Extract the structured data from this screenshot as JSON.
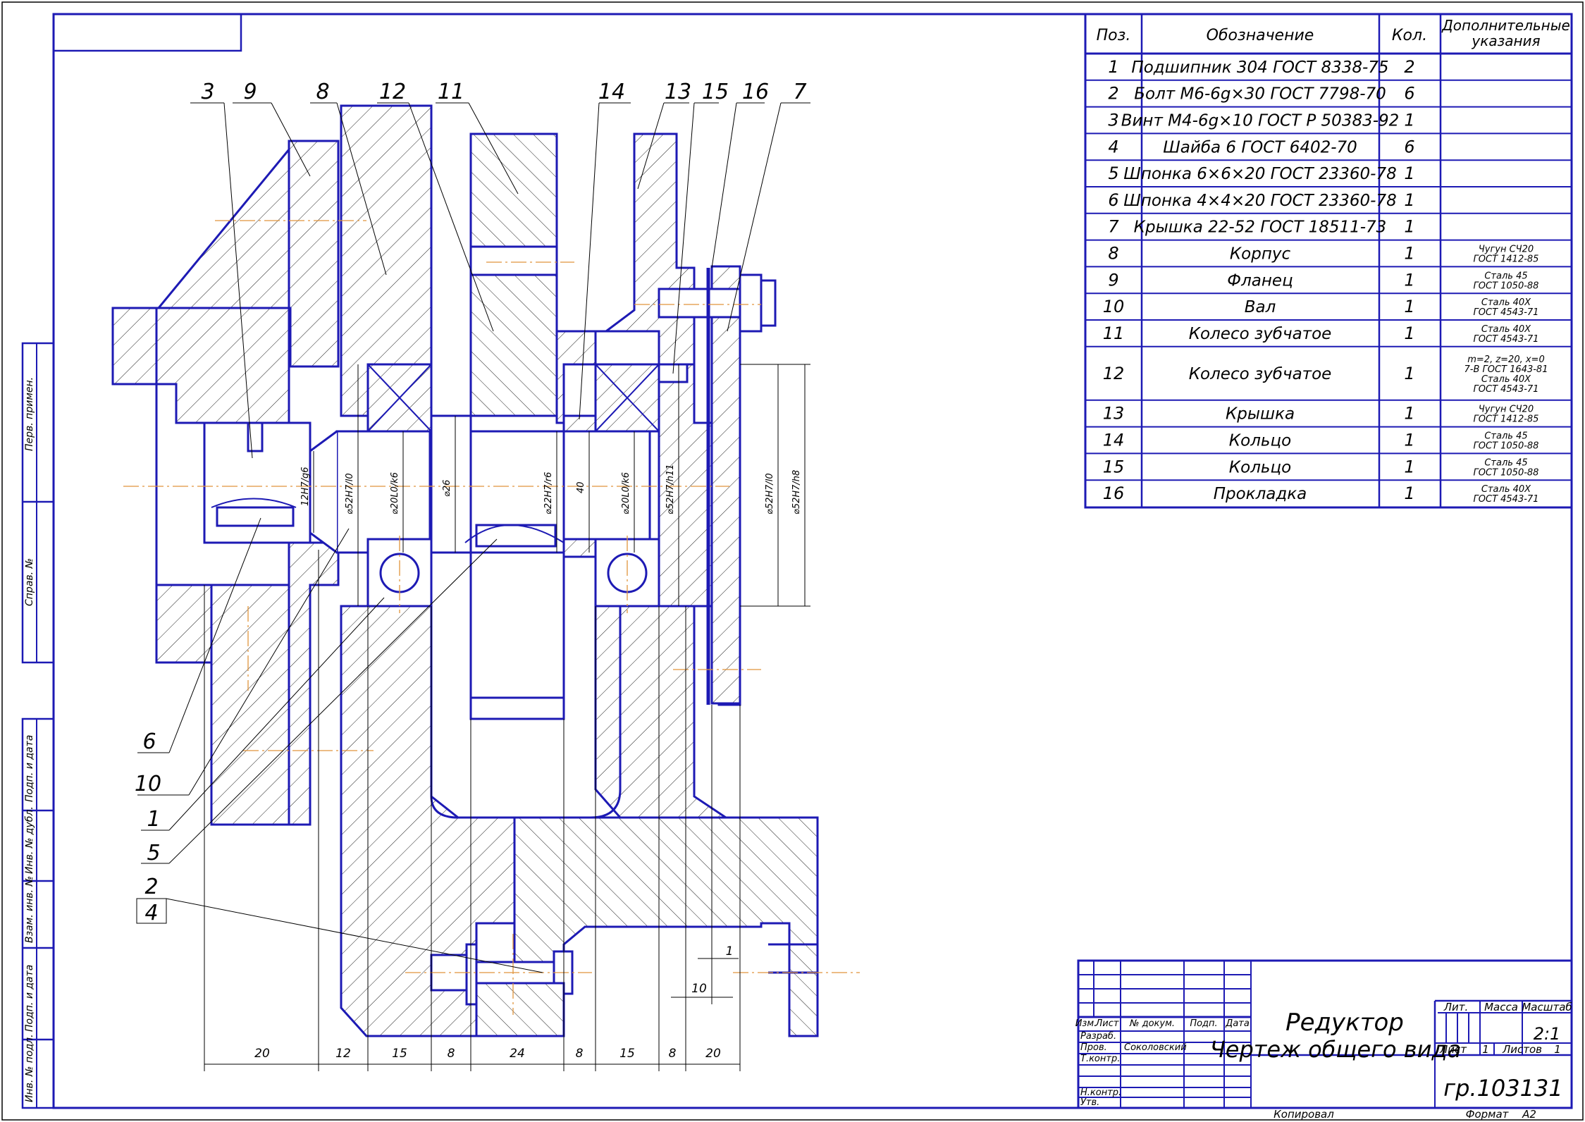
{
  "spec": {
    "headers": {
      "pos": "Поз.",
      "designation": "Обозначение",
      "qty": "Кол.",
      "notes": "Дополнительные указания"
    },
    "rows": [
      {
        "pos": "1",
        "name": "Подшипник 304 ГОСТ 8338-75",
        "qty": "2",
        "note": ""
      },
      {
        "pos": "2",
        "name": "Болт М6-6g×30 ГОСТ 7798-70",
        "qty": "6",
        "note": ""
      },
      {
        "pos": "3",
        "name": "Винт М4-6g×10 ГОСТ Р 50383-92",
        "qty": "1",
        "note": ""
      },
      {
        "pos": "4",
        "name": "Шайба 6 ГОСТ 6402-70",
        "qty": "6",
        "note": ""
      },
      {
        "pos": "5",
        "name": "Шпонка 6×6×20 ГОСТ 23360-78",
        "qty": "1",
        "note": ""
      },
      {
        "pos": "6",
        "name": "Шпонка 4×4×20 ГОСТ 23360-78",
        "qty": "1",
        "note": ""
      },
      {
        "pos": "7",
        "name": "Крышка 22-52 ГОСТ 18511-73",
        "qty": "1",
        "note": ""
      },
      {
        "pos": "8",
        "name": "Корпус",
        "qty": "1",
        "note": "Чугун СЧ20\nГОСТ 1412-85"
      },
      {
        "pos": "9",
        "name": "Фланец",
        "qty": "1",
        "note": "Сталь 45\nГОСТ 1050-88"
      },
      {
        "pos": "10",
        "name": "Вал",
        "qty": "1",
        "note": "Сталь 40Х\nГОСТ 4543-71"
      },
      {
        "pos": "11",
        "name": "Колесо зубчатое",
        "qty": "1",
        "note": "Сталь 40Х\nГОСТ 4543-71"
      },
      {
        "pos": "12",
        "name": "Колесо зубчатое",
        "qty": "1",
        "note": "m=2, z=20, x=0\n7-В ГОСТ 1643-81\nСталь 40Х\nГОСТ 4543-71"
      },
      {
        "pos": "13",
        "name": "Крышка",
        "qty": "1",
        "note": "Чугун СЧ20\nГОСТ 1412-85"
      },
      {
        "pos": "14",
        "name": "Кольцо",
        "qty": "1",
        "note": "Сталь 45\nГОСТ 1050-88"
      },
      {
        "pos": "15",
        "name": "Кольцо",
        "qty": "1",
        "note": "Сталь 45\nГОСТ 1050-88"
      },
      {
        "pos": "16",
        "name": "Прокладка",
        "qty": "1",
        "note": "Сталь 40Х\nГОСТ 4543-71"
      }
    ]
  },
  "titleblock": {
    "col_izm": "Изм.",
    "col_list": "Лист",
    "col_doc": "№ докум.",
    "col_sign": "Подп.",
    "col_date": "Дата",
    "razrab": "Разраб.",
    "prov": "Пров.",
    "prov_name": "Соколовский",
    "tkontr": "Т.контр.",
    "nkontr": "Н.контр.",
    "utv": "Утв.",
    "title1": "Редуктор",
    "title2": "Чертеж общего вида",
    "lit": "Лит.",
    "mass": "Масса",
    "scale_label": "Масштаб",
    "scale": "2:1",
    "sheet_label": "Лист",
    "sheet": "1",
    "sheets_label": "Листов",
    "sheets": "1",
    "group": "гр.103131",
    "copied": "Копировал",
    "format_label": "Формат",
    "format": "А2"
  },
  "sidebar": {
    "perv": "Перв. примен.",
    "sprav": "Справ. №",
    "podp1": "Подп. и дата",
    "inv_dubl": "Инв. № дубл.",
    "vzam": "Взам. инв. №",
    "podp2": "Подп. и дата",
    "inv_podl": "Инв. № подл."
  },
  "leaders": [
    "3",
    "9",
    "8",
    "12",
    "11",
    "14",
    "13",
    "15",
    "16",
    "7",
    "6",
    "10",
    "1",
    "5",
    "2",
    "4"
  ],
  "dims_bottom": [
    "20",
    "12",
    "15",
    "8",
    "24",
    "8",
    "15",
    "8",
    "20"
  ],
  "dims_small": [
    "1",
    "10"
  ],
  "dims_vert": [
    "12H7/g6",
    "⌀52H7/l0",
    "⌀20L0/k6",
    "⌀26",
    "⌀22H7/r6",
    "40",
    "⌀20L0/k6",
    "⌀52H7/h11",
    "⌀52H7/l0",
    "⌀52H7/h8"
  ]
}
